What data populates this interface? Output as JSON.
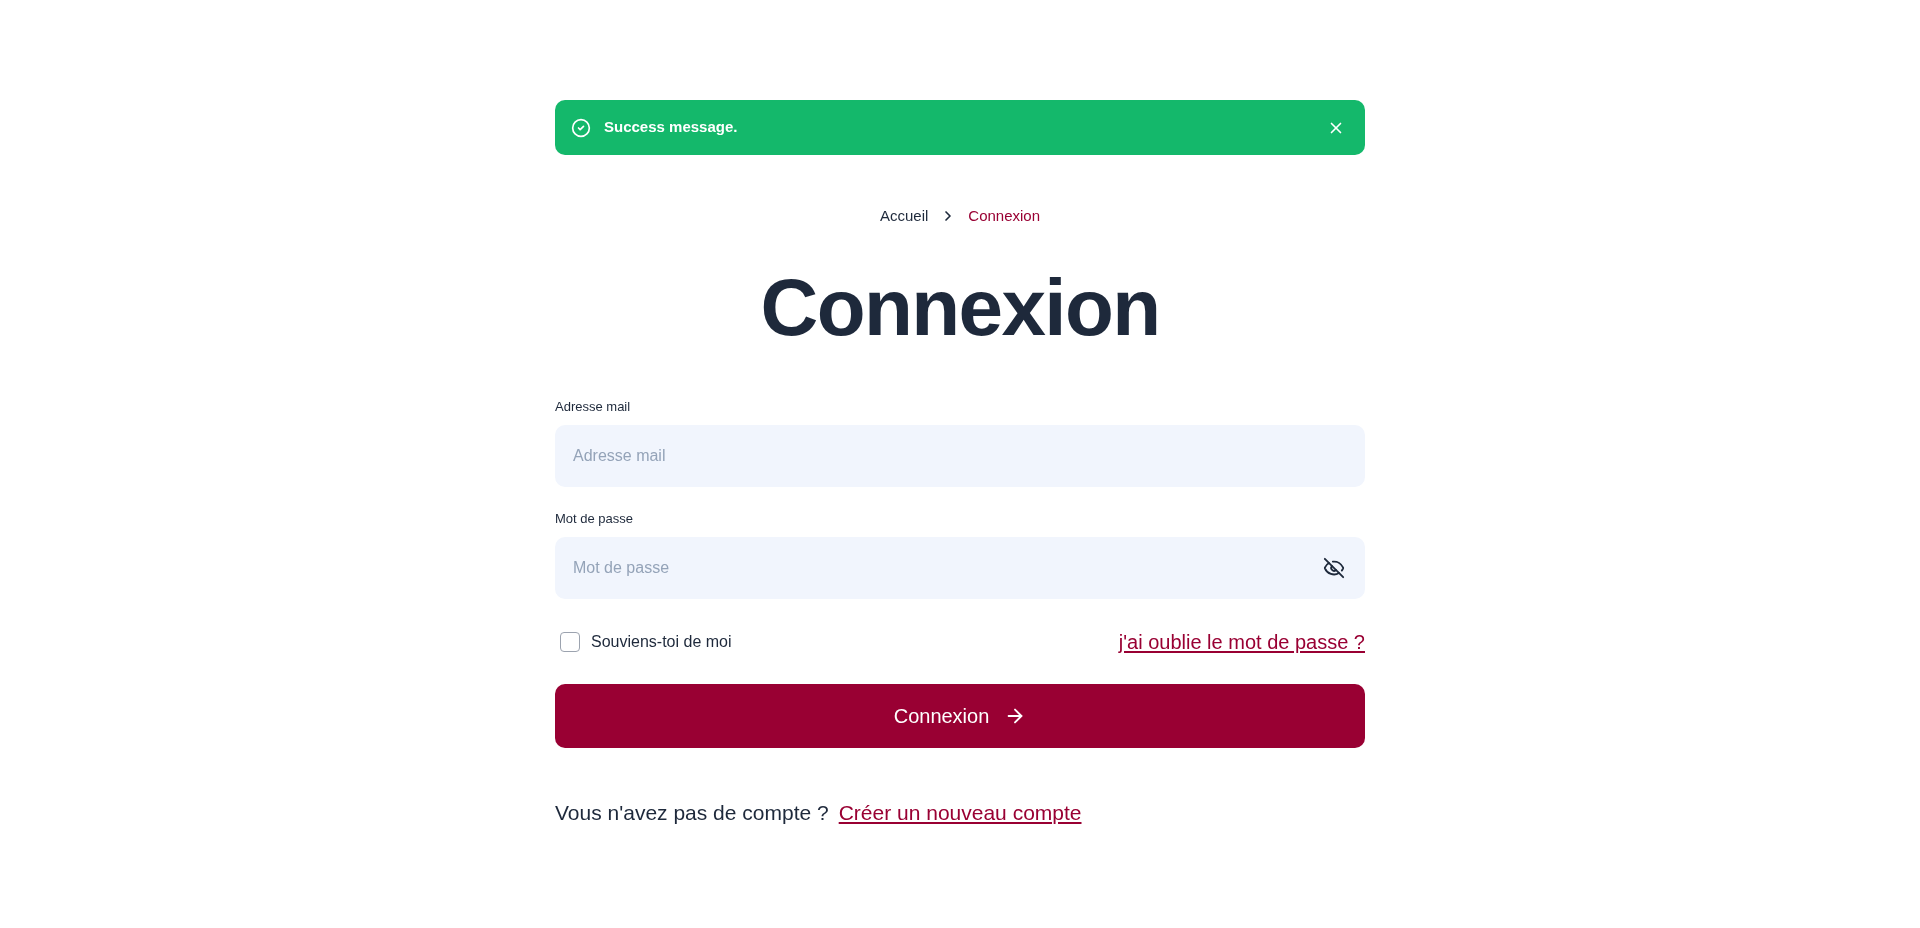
{
  "alert": {
    "kind": "success",
    "message": "Success message."
  },
  "breadcrumb": [
    {
      "label": "Accueil",
      "current": false
    },
    {
      "label": "Connexion",
      "current": true
    }
  ],
  "title": "Connexion",
  "fields": [
    {
      "kind": "email",
      "label": "Adresse mail",
      "placeholder": "Adresse mail"
    },
    {
      "kind": "password",
      "label": "Mot de passe",
      "placeholder": "Mot de passe"
    }
  ],
  "remember": {
    "label": "Souviens-toi de moi",
    "checked": false
  },
  "forgot_link": "j'ai oublie le mot de passe ?",
  "submit_button": "Connexion",
  "signup": {
    "prompt": "Vous n'avez pas de compte ?",
    "link": "Créer un nouveau compte"
  }
}
